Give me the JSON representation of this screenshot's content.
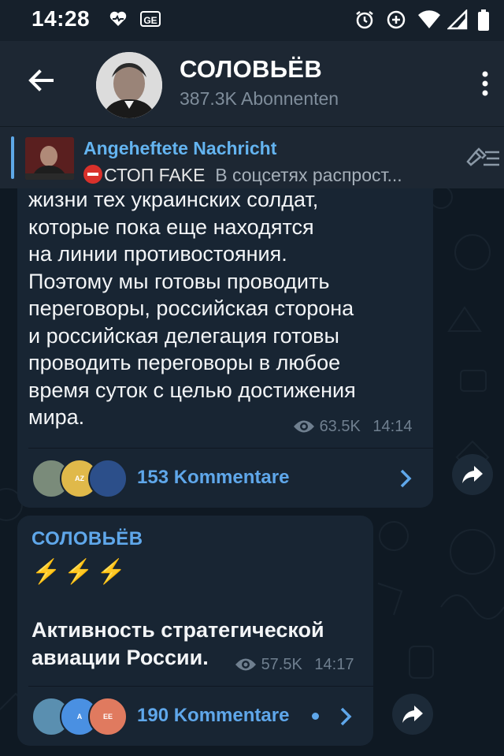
{
  "status_bar": {
    "time": "14:28",
    "icons": [
      "heartbeat-icon",
      "ge-icon",
      "alarm-icon",
      "data-saver-icon",
      "wifi-icon",
      "signal-icon",
      "battery-icon"
    ],
    "ge_label": "GE"
  },
  "header": {
    "title": "СОЛОВЬЁВ",
    "subtitle": "387.3K Abonnenten",
    "back_icon": "arrow-left-icon",
    "menu_icon": "more-vertical-icon"
  },
  "pinned": {
    "title": "Angeheftete Nachricht",
    "stop_label": "СТОП FAKE",
    "text": "В соцсетях распрост...",
    "icon": "pin-list-icon"
  },
  "messages": [
    {
      "lines": [
        "жизни тех украинских солдат,",
        "которые пока еще находятся",
        "на линии противостояния.",
        "Поэтому мы готовы проводить",
        "переговоры, российская сторона",
        "и российская делегация готовы",
        "проводить переговоры в любое",
        "время суток с целью достижения",
        "мира."
      ],
      "views": "63.5K",
      "time": "14:14",
      "comments": "153 Kommentare",
      "avatars": [
        "",
        "AZ",
        ""
      ]
    },
    {
      "author": "СОЛОВЬЁВ",
      "bolts": "⚡⚡⚡",
      "lines": [
        "Активность стратегической",
        "авиации России."
      ],
      "views": "57.5K",
      "time": "14:17",
      "comments": "190 Kommentare",
      "avatars": [
        "",
        "A",
        "EE"
      ]
    }
  ],
  "colors": {
    "background": "#0e1621",
    "header": "#1d2733",
    "bubble": "#182533",
    "accent": "#5fa7ea",
    "muted": "#6f7f8f"
  }
}
